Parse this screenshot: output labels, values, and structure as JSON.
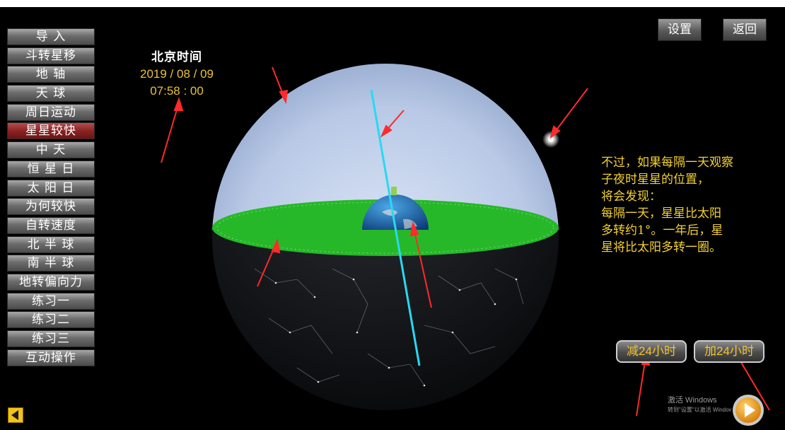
{
  "menu": {
    "items": [
      {
        "label": "导  入"
      },
      {
        "label": "斗转星移"
      },
      {
        "label": "地  轴"
      },
      {
        "label": "天  球"
      },
      {
        "label": "周日运动"
      },
      {
        "label": "星星较快",
        "active": true
      },
      {
        "label": "中  天"
      },
      {
        "label": "恒 星 日"
      },
      {
        "label": "太 阳 日"
      },
      {
        "label": "为何较快"
      },
      {
        "label": "自转速度"
      },
      {
        "label": "北 半 球"
      },
      {
        "label": "南 半 球"
      },
      {
        "label": "地转偏向力"
      },
      {
        "label": "练习一"
      },
      {
        "label": "练习二"
      },
      {
        "label": "练习三"
      },
      {
        "label": "互动操作"
      }
    ]
  },
  "toolbar": {
    "settings_label": "设置",
    "back_label": "返回"
  },
  "clock": {
    "title": "北京时间",
    "date": "2019 / 08 / 09",
    "time": "07:58 : 00"
  },
  "description": {
    "lines": [
      "不过，如果每隔一天观察",
      "子夜时星星的位置，",
      "将会发现：",
      "每隔一天，星星比太阳",
      "多转约1°。一年后，星",
      "星将比太阳多转一圈。"
    ]
  },
  "controls": {
    "minus_label": "减24小时",
    "plus_label": "加24小时"
  },
  "watermark": {
    "title": "激活 Windows",
    "subtitle": "转到\"设置\"以激活 Windows。"
  },
  "colors": {
    "accent": "#f4d12f",
    "active_menu": "#8c2323",
    "horizon": "#2fc72f",
    "axis": "#2ee6ff",
    "arrow": "#ff2a2a"
  },
  "icons": {
    "back": "left-arrow-icon",
    "play": "play-icon"
  }
}
